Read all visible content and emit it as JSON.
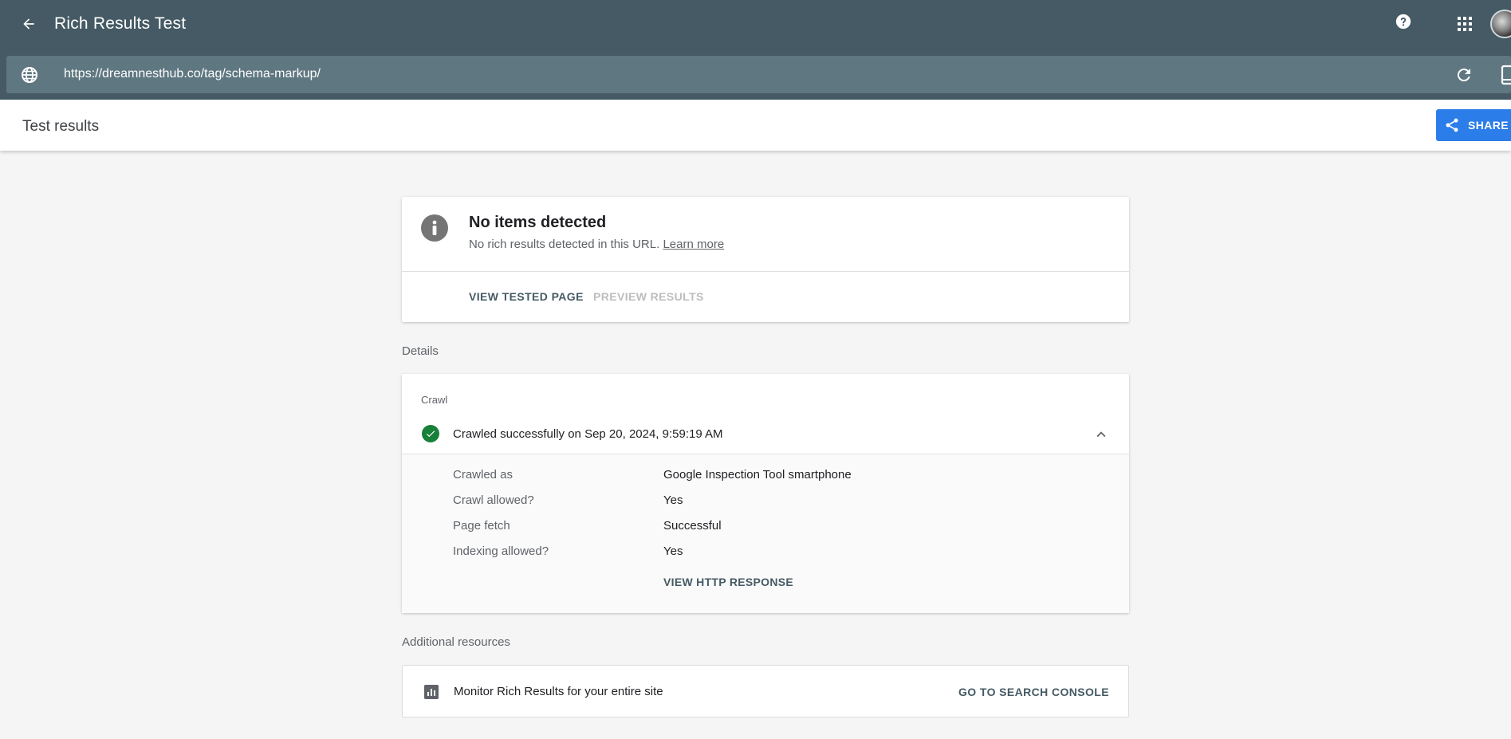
{
  "header": {
    "title": "Rich Results Test",
    "url": "https://dreamnesthub.co/tag/schema-markup/"
  },
  "subheader": {
    "title": "Test results",
    "share_label": "SHARE"
  },
  "summary": {
    "heading": "No items detected",
    "subtext": "No rich results detected in this URL.",
    "learn_more": "Learn more",
    "view_tested_page": "VIEW TESTED PAGE",
    "preview_results": "PREVIEW RESULTS"
  },
  "details": {
    "section_label": "Details",
    "crawl_heading": "Crawl",
    "status": "Crawled successfully on Sep 20, 2024, 9:59:19 AM",
    "rows": [
      {
        "label": "Crawled as",
        "value": "Google Inspection Tool smartphone"
      },
      {
        "label": "Crawl allowed?",
        "value": "Yes"
      },
      {
        "label": "Page fetch",
        "value": "Successful"
      },
      {
        "label": "Indexing allowed?",
        "value": "Yes"
      }
    ],
    "http_button": "VIEW HTTP RESPONSE"
  },
  "resources": {
    "section_label": "Additional resources",
    "item_text": "Monitor Rich Results for your entire site",
    "item_button": "GO TO SEARCH CONSOLE"
  },
  "icons": {
    "back": "back-arrow-icon",
    "help": "help-icon",
    "apps": "apps-grid-icon",
    "globe": "globe-icon",
    "reload": "reload-icon",
    "device": "smartphone-icon",
    "share": "share-icon",
    "info": "info-icon",
    "check": "check-circle-icon",
    "chevron": "chevron-up-icon",
    "chart": "bar-chart-icon"
  },
  "colors": {
    "appbar": "#455a64",
    "urlbar": "#5f7780",
    "primary": "#2b7de9",
    "success": "#188038"
  }
}
